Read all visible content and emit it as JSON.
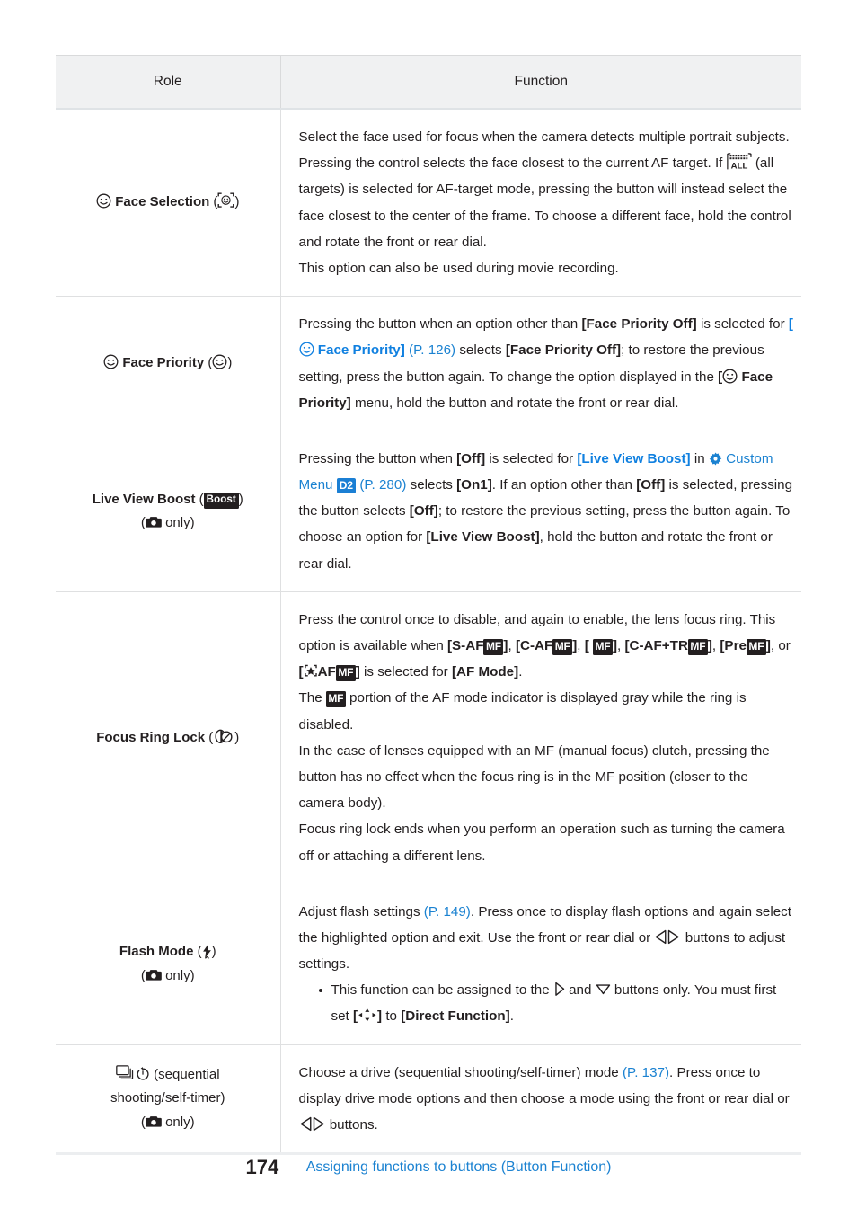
{
  "table": {
    "headers": {
      "role": "Role",
      "function": "Function"
    },
    "rows": [
      {
        "role_label": "Face Selection",
        "role_icon": "face-smiley-icon",
        "role_paren_icon": "face-in-frame-icon",
        "function_paragraphs": [
          "Select the face used for focus when the camera detects multiple portrait subjects. Pressing the control selects the face closest to the current AF target. If [ALL-targets icon] (all targets) is selected for AF-target mode, pressing the button will instead select the face closest to the center of the frame. To choose a different face, hold the control and rotate the front or rear dial.",
          "This option can also be used during movie recording."
        ],
        "fragments": {
          "f1": "Select the face used for focus when the camera detects multiple portrait subjects. Pressing the control selects the face closest to the current AF target. If ",
          "f2": " (all targets) is selected for AF-target mode, pressing the button will instead select the face closest to the center of the frame. To choose a different face, hold the control and rotate the front or rear dial.",
          "f3": "This option can also be used during movie recording."
        }
      },
      {
        "role_label": "Face Priority",
        "role_icon": "face-smiley-icon",
        "role_paren_icon": "face-smiley-icon",
        "fragments": {
          "f1": "Pressing the button when an option other than ",
          "b1": "[Face Priority Off]",
          "f2": " is selected for ",
          "l1": "[",
          "l2": " Face Priority]",
          "l3": "(P. 126)",
          "f3": " selects ",
          "b2": "[Face Priority Off]",
          "f4": "; to restore the previous setting, press the button again. To change the option displayed in the ",
          "b3a": "[",
          "b3b": " Face Priority]",
          "f5": " menu, hold the button and rotate the front or rear dial."
        }
      },
      {
        "role_label": "Live View Boost",
        "role_badge": "Boost",
        "role_sub_only": "only",
        "role_sub_icon": "camera-icon",
        "fragments": {
          "f1": "Pressing the button when ",
          "b1": "[Off]",
          "f2": " is selected for ",
          "l1": "[Live View Boost]",
          "f3": "in ",
          "l2": "Custom Menu",
          "badge": "D2",
          "l3": "(P. 280)",
          "f4": " selects ",
          "b2": "[On1]",
          "f5": ". If an option other than ",
          "b3": "[Off]",
          "f6": " is selected, pressing the button selects ",
          "b4": "[Off]",
          "f7": "; to restore the previous setting, press the button again. To choose an option for ",
          "b5": "[Live View Boost]",
          "f8": ", hold the button and rotate the front or rear dial."
        }
      },
      {
        "role_label": "Focus Ring Lock",
        "role_paren_icon": "focus-ring-lock-icon",
        "fragments": {
          "f1": "Press the control once to disable, and again to enable, the lens focus ring. This option is available when ",
          "b1a": "[S-AF",
          "b1b": "]",
          "b2a": "[C-AF",
          "b2b": "]",
          "b3a": "[",
          "b3b": "]",
          "b4a": "[C-AF+TR",
          "b4b": "]",
          "b5a": "[Pre",
          "b5b": "]",
          "f2": ", or ",
          "b6a": "[",
          "b6b": "AF",
          "b6c": "]",
          "f3": " is selected for ",
          "b7": "[AF Mode]",
          "f4": ".",
          "p2a": "The ",
          "p2b": " portion of the AF mode indicator is displayed gray while the ring is disabled.",
          "p3": "In the case of lenses equipped with an MF (manual focus) clutch, pressing the button has no effect when the focus ring is in the MF position (closer to the camera body).",
          "p4": "Focus ring lock ends when you perform an operation such as turning the camera off or attaching a different lens."
        }
      },
      {
        "role_label": "Flash Mode",
        "role_paren_icon": "flash-icon",
        "role_sub_only": "only",
        "role_sub_icon": "camera-icon",
        "fragments": {
          "f1": "Adjust flash settings ",
          "l1": "(P. 149)",
          "f2": ". Press once to display flash options and again select the highlighted option and exit. Use the front or rear dial or ",
          "f3": " buttons to adjust settings.",
          "bl1a": "This function can be assigned to the ",
          "bl1b": " and ",
          "bl1c": " buttons only. You must first set ",
          "bl1d": " to ",
          "bl1e": "[Direct Function]",
          "bl1f": "."
        }
      },
      {
        "role_label": "(sequential shooting/self-timer)",
        "role_line1": "(sequential",
        "role_line2": "shooting/self-timer)",
        "role_sub_only": "only",
        "role_sub_icon": "camera-icon",
        "fragments": {
          "f1": "Choose a drive (sequential shooting/self-timer) mode ",
          "l1": "(P. 137)",
          "f2": ". Press once to display drive mode options and then choose a mode using the front or rear dial or ",
          "f3": " buttons."
        }
      }
    ]
  },
  "footer": {
    "page_number": "174",
    "section_title": "Assigning functions to buttons (Button Function)"
  },
  "colors": {
    "link_blue": "#1b82d1",
    "accent_blue": "#1080e0",
    "badge_dark": "#231f20",
    "header_bg": "#f0f1f2"
  }
}
